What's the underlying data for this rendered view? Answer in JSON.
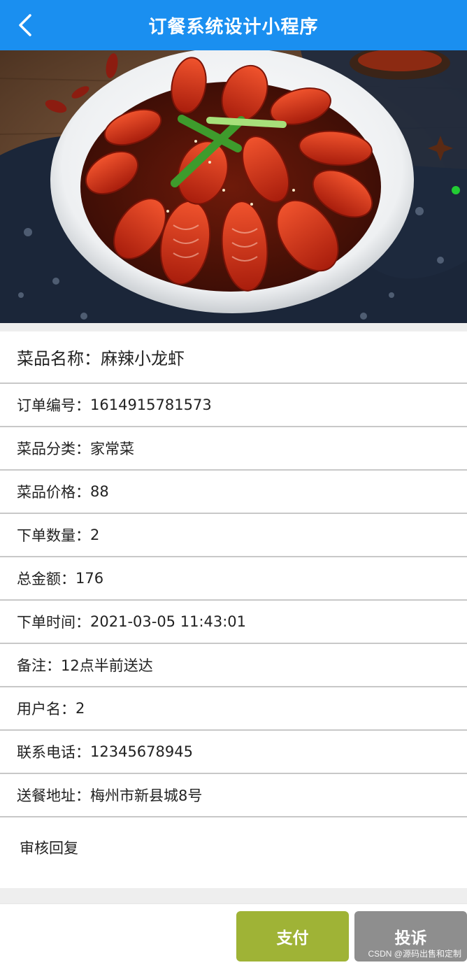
{
  "header": {
    "title": "订餐系统设计小程序",
    "back_icon": "chevron-left-icon",
    "background": "#1a8ff0"
  },
  "hero": {
    "image": "dish-photo-spicy-crayfish"
  },
  "dish": {
    "name_label": "菜品名称：",
    "name_value": "麻辣小龙虾"
  },
  "fields": [
    {
      "label": "订单编号：",
      "value": "1614915781573"
    },
    {
      "label": "菜品分类：",
      "value": "家常菜"
    },
    {
      "label": "菜品价格：",
      "value": "88"
    },
    {
      "label": "下单数量：",
      "value": "2"
    },
    {
      "label": "总金额：",
      "value": "176"
    },
    {
      "label": "下单时间：",
      "value": "2021-03-05 11:43:01"
    },
    {
      "label": "备注：",
      "value": "12点半前送达"
    },
    {
      "label": "用户名：",
      "value": "2"
    },
    {
      "label": "联系电话：",
      "value": "12345678945"
    },
    {
      "label": "送餐地址：",
      "value": "梅州市新县城8号"
    }
  ],
  "review": {
    "label": "审核回复"
  },
  "actions": {
    "pay_label": "支付",
    "complain_label": "投诉",
    "pay_color": "#9fb336",
    "complain_color": "#8e8e8e"
  },
  "watermark": "CSDN @源码出售和定制"
}
